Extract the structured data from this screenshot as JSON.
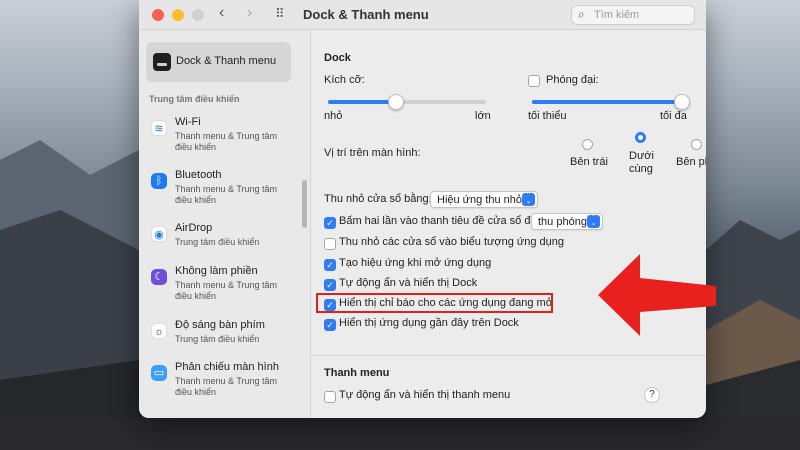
{
  "window": {
    "title": "Dock & Thanh menu",
    "search_placeholder": "Tìm kiếm"
  },
  "sidebar": {
    "selected_label": "Dock & Thanh menu",
    "section_title": "Trung tâm điều khiển",
    "items": [
      {
        "title": "Wi-Fi",
        "subtitle": "Thanh menu & Trung tâm điều khiển",
        "icon": "wifi-icon",
        "color": "#ffffff"
      },
      {
        "title": "Bluetooth",
        "subtitle": "Thanh menu & Trung tâm điều khiển",
        "icon": "bluetooth-icon",
        "color": "#1f7af0"
      },
      {
        "title": "AirDrop",
        "subtitle": "Trung tâm điều khiển",
        "icon": "airdrop-icon",
        "color": "#ffffff"
      },
      {
        "title": "Không làm phiền",
        "subtitle": "Thanh menu & Trung tâm điều khiển",
        "icon": "moon-icon",
        "color": "#6e4fd8"
      },
      {
        "title": "Độ sáng bàn phím",
        "subtitle": "Trung tâm điều khiển",
        "icon": "keyboard-brightness-icon",
        "color": "#ffffff"
      },
      {
        "title": "Phản chiếu màn hình",
        "subtitle": "Thanh menu & Trung tâm điều khiển",
        "icon": "screen-mirroring-icon",
        "color": "#3ba0f5"
      }
    ]
  },
  "dock": {
    "heading": "Dock",
    "size_label": "Kích cỡ:",
    "size_min": "nhỏ",
    "size_max": "lớn",
    "size_value": 0.43,
    "magnification_label": "Phóng đại:",
    "magnification_checked": false,
    "mag_min": "tối thiểu",
    "mag_max": "tối đa",
    "mag_value": 1.0,
    "position_label": "Vị trí trên màn hình:",
    "position_left": "Bên trái",
    "position_bottom_line1": "Dưới",
    "position_bottom_line2": "cùng",
    "position_right": "Bên phải",
    "position_selected": "bottom",
    "minimize_label": "Thu nhỏ cửa sổ bằng:",
    "minimize_value": "Hiệu ứng thu nhỏ",
    "options": [
      {
        "label": "Bấm hai lần vào thanh tiêu đề cửa sổ để",
        "checked": true,
        "popup": "thu phóng"
      },
      {
        "label": "Thu nhỏ các cửa sổ vào biểu tượng ứng dụng",
        "checked": false
      },
      {
        "label": "Tạo hiệu ứng khi mở ứng dụng",
        "checked": true
      },
      {
        "label": "Tự động ẩn và hiển thị Dock",
        "checked": true
      },
      {
        "label": "Hiển thị chỉ báo cho các ứng dụng đang mở",
        "checked": true
      },
      {
        "label": "Hiển thị ứng dụng gần đây trên Dock",
        "checked": true
      }
    ]
  },
  "menubar": {
    "heading": "Thanh menu",
    "autohide_label": "Tự động ẩn và hiển thị thanh menu",
    "autohide_checked": false
  },
  "help_label": "?",
  "colors": {
    "accent": "#2f7cf6",
    "annotation": "#e0201f"
  }
}
